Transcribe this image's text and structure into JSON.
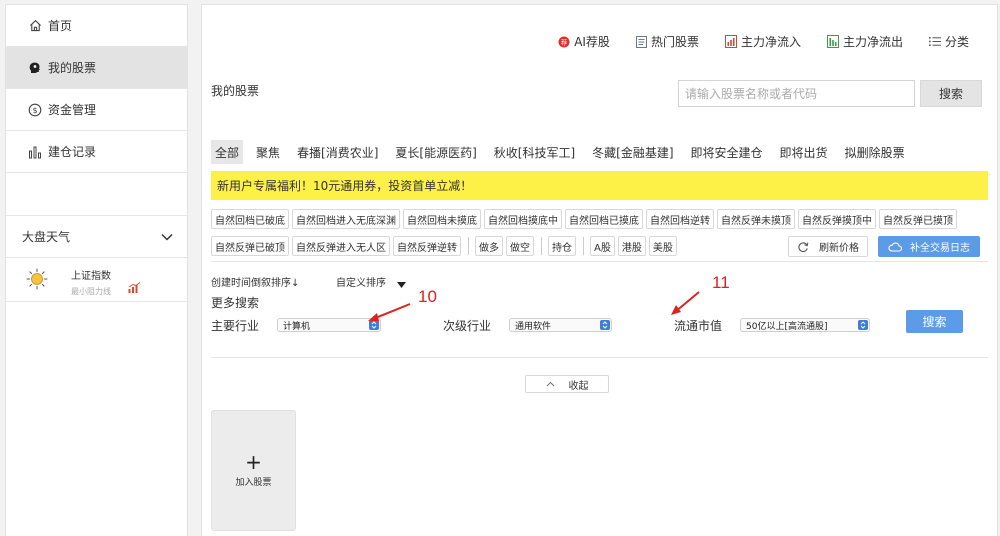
{
  "sidebar": {
    "nav": [
      {
        "label": "首页",
        "icon": "home-icon"
      },
      {
        "label": "我的股票",
        "icon": "brain-head-icon"
      },
      {
        "label": "资金管理",
        "icon": "money-icon"
      },
      {
        "label": "建仓记录",
        "icon": "bar-chart-icon"
      }
    ],
    "weather": {
      "title": "大盘天气",
      "index_name": "上证指数",
      "index_sub": "最小阻力线"
    }
  },
  "toolbar": {
    "items": [
      {
        "label": "AI荐股",
        "icon": "ai-badge-icon"
      },
      {
        "label": "热门股票",
        "icon": "document-icon"
      },
      {
        "label": "主力净流入",
        "icon": "inflow-icon"
      },
      {
        "label": "主力净流出",
        "icon": "outflow-icon"
      },
      {
        "label": "分类",
        "icon": "list-icon"
      }
    ]
  },
  "page": {
    "title": "我的股票",
    "search_placeholder": "请输入股票名称或者代码",
    "search_label": "搜索"
  },
  "tabs": [
    "全部",
    "聚焦",
    "春播[消费农业]",
    "夏长[能源医药]",
    "秋收[科技军工]",
    "冬藏[金融基建]",
    "即将安全建仓",
    "即将出货",
    "拟删除股票"
  ],
  "banner": "新用户专属福利！10元通用券，投资首单立减！",
  "tags_row1": [
    "自然回档已破底",
    "自然回档进入无底深渊",
    "自然回档未摸底",
    "自然回档摸底中",
    "自然回档已摸底",
    "自然回档逆转",
    "自然反弹未摸顶",
    "自然反弹摸顶中",
    "自然反弹已摸顶"
  ],
  "tags_row2_a": [
    "自然反弹已破顶",
    "自然反弹进入无人区",
    "自然反弹逆转"
  ],
  "tags_row2_b": [
    "做多",
    "做空"
  ],
  "tags_row2_c": [
    "持仓"
  ],
  "tags_row2_d": [
    "A股",
    "港股",
    "美股"
  ],
  "refresh_label": "刷新价格",
  "log_label": "补全交易日志",
  "sort": {
    "time_label": "创建时间倒叙排序↓",
    "custom_label": "自定义排序"
  },
  "filters": {
    "more_label": "更多搜索",
    "industry_label": "主要行业",
    "industry_value": "计算机",
    "sub_industry_label": "次级行业",
    "sub_industry_value": "通用软件",
    "cap_label": "流通市值",
    "cap_value": "50亿以上[高流通股]",
    "search_label": "搜索"
  },
  "annotations": {
    "a10": "10",
    "a11": "11"
  },
  "collapse_label": "收起",
  "add_card_label": "加入股票",
  "colors": {
    "accent_blue": "#5b9be8",
    "banner_yellow": "#fdf147",
    "annotation_red": "#d22"
  }
}
